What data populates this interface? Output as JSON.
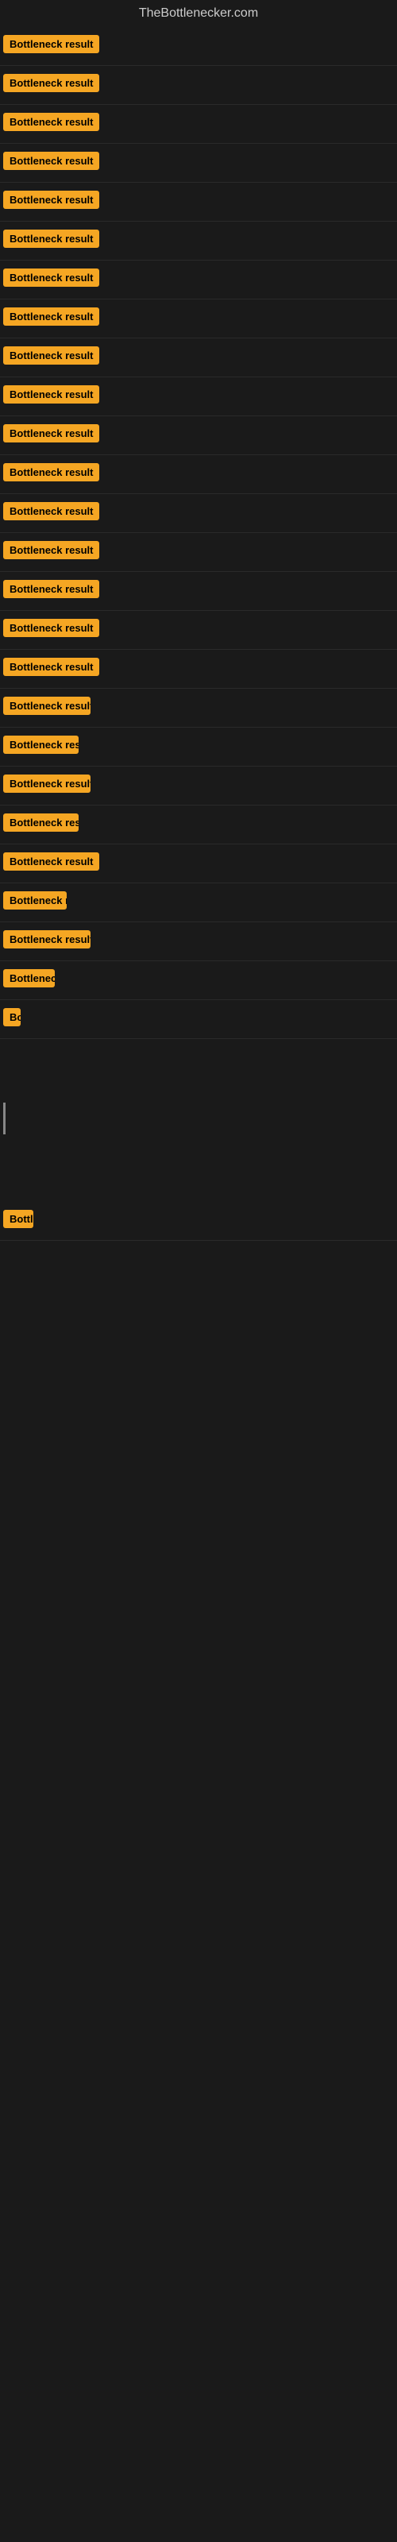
{
  "site": {
    "title": "TheBottlenecker.com"
  },
  "badge_label": "Bottleneck result",
  "rows": [
    {
      "id": 1,
      "size": "full",
      "visible": true
    },
    {
      "id": 2,
      "size": "full",
      "visible": true
    },
    {
      "id": 3,
      "size": "full",
      "visible": true
    },
    {
      "id": 4,
      "size": "full",
      "visible": true
    },
    {
      "id": 5,
      "size": "full",
      "visible": true
    },
    {
      "id": 6,
      "size": "full",
      "visible": true
    },
    {
      "id": 7,
      "size": "full",
      "visible": true
    },
    {
      "id": 8,
      "size": "full",
      "visible": true
    },
    {
      "id": 9,
      "size": "full",
      "visible": true
    },
    {
      "id": 10,
      "size": "full",
      "visible": true
    },
    {
      "id": 11,
      "size": "full",
      "visible": true
    },
    {
      "id": 12,
      "size": "full",
      "visible": true
    },
    {
      "id": 13,
      "size": "full",
      "visible": true
    },
    {
      "id": 14,
      "size": "full",
      "visible": true
    },
    {
      "id": 15,
      "size": "full",
      "visible": true
    },
    {
      "id": 16,
      "size": "trunc1",
      "visible": true
    },
    {
      "id": 17,
      "size": "trunc2",
      "visible": true
    },
    {
      "id": 18,
      "size": "trunc3",
      "visible": true
    },
    {
      "id": 19,
      "size": "trunc4",
      "visible": true
    },
    {
      "id": 20,
      "size": "trunc3",
      "visible": true
    },
    {
      "id": 21,
      "size": "trunc4",
      "visible": true
    },
    {
      "id": 22,
      "size": "trunc1",
      "visible": true
    },
    {
      "id": 23,
      "size": "trunc5",
      "visible": true
    },
    {
      "id": 24,
      "size": "trunc3",
      "visible": true
    },
    {
      "id": 25,
      "size": "trunc6",
      "visible": true
    },
    {
      "id": 26,
      "size": "trunc9",
      "visible": true
    },
    {
      "id": 27,
      "size": "empty",
      "visible": false
    },
    {
      "id": 28,
      "size": "bar",
      "visible": false
    },
    {
      "id": 29,
      "size": "empty",
      "visible": false
    },
    {
      "id": 30,
      "size": "last",
      "visible": true
    },
    {
      "id": 31,
      "size": "empty",
      "visible": false
    },
    {
      "id": 32,
      "size": "empty",
      "visible": false
    },
    {
      "id": 33,
      "size": "empty",
      "visible": false
    }
  ]
}
